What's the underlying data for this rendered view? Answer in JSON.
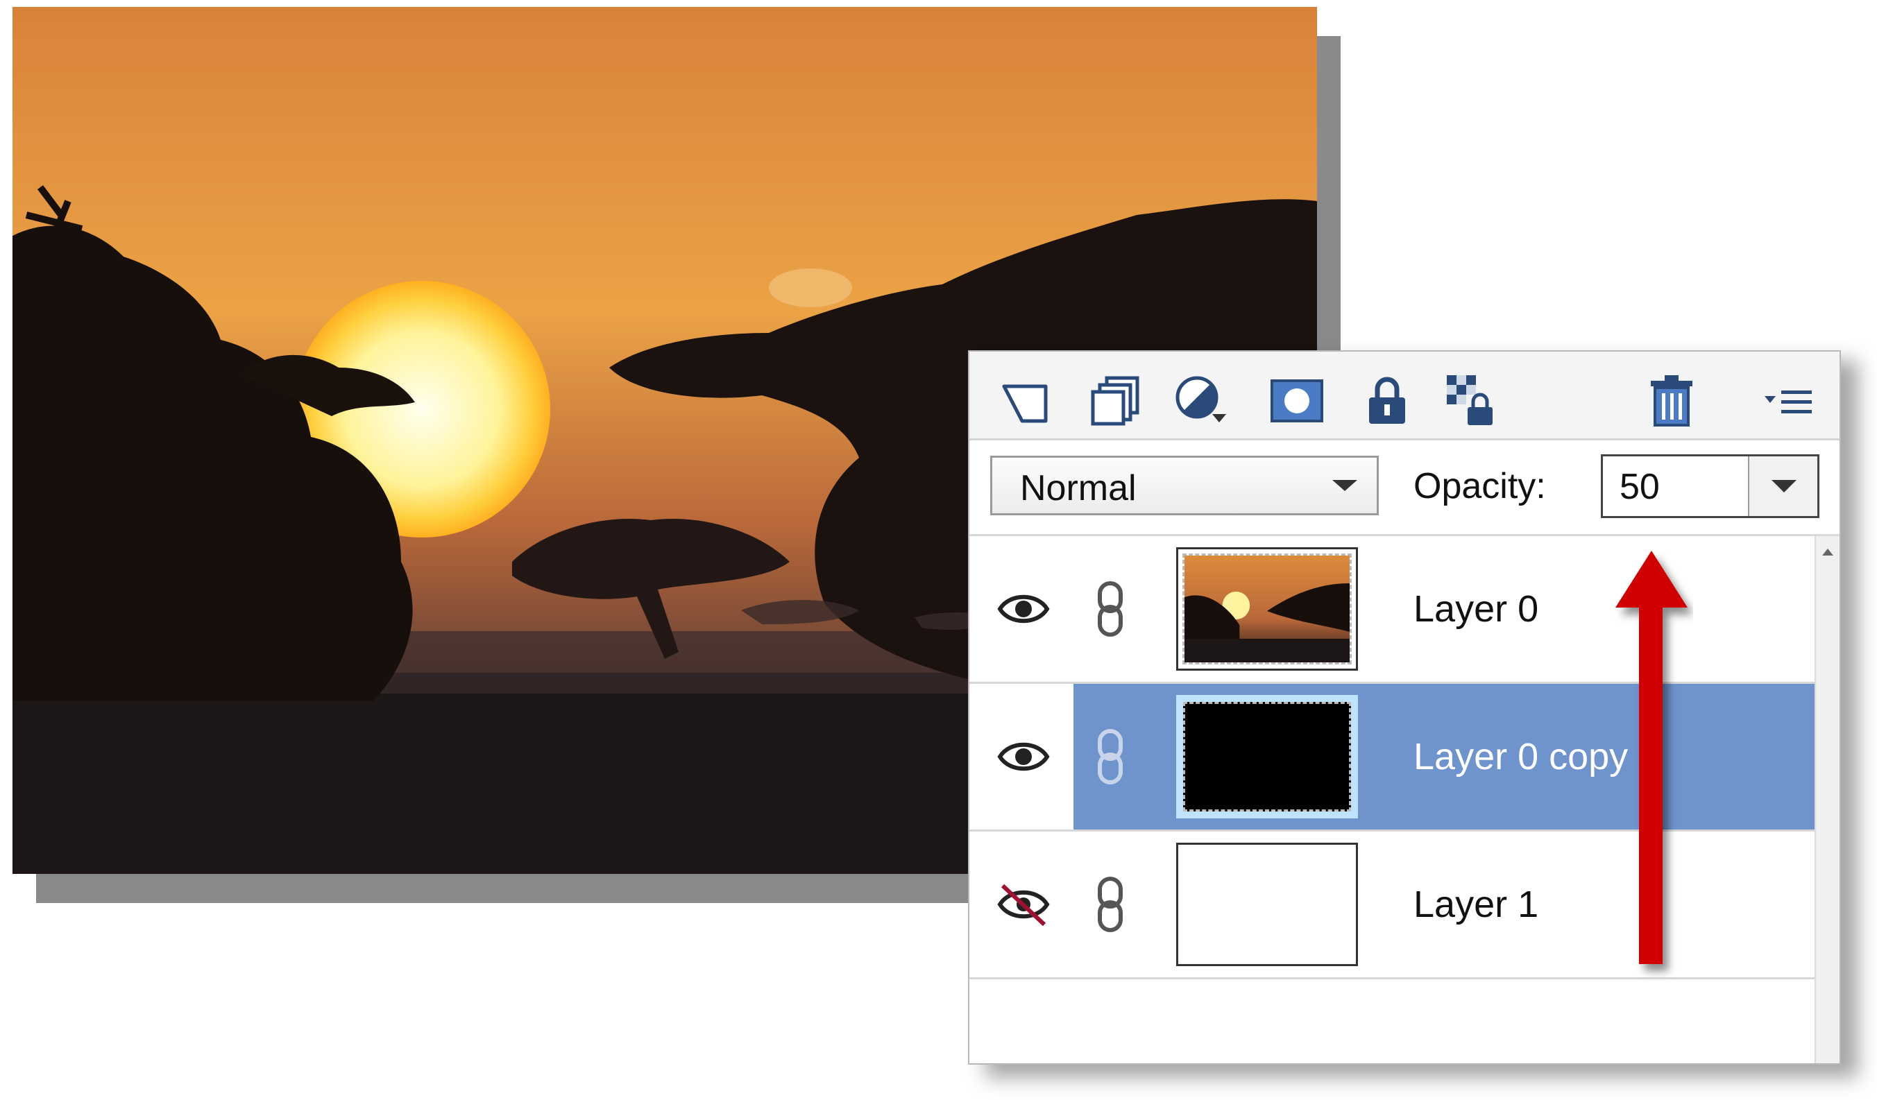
{
  "toolbar": {
    "icons": [
      "new-layer-icon",
      "duplicate-layer-icon",
      "adjustment-layer-icon",
      "mask-icon",
      "lock-icon",
      "lock-transparency-icon",
      "delete-icon",
      "panel-menu-icon"
    ]
  },
  "blend": {
    "mode": "Normal",
    "opacity_label": "Opacity:",
    "opacity_value": "50"
  },
  "layers": [
    {
      "name": "Layer 0",
      "visible": true,
      "selected": false
    },
    {
      "name": "Layer 0 copy",
      "visible": true,
      "selected": true
    },
    {
      "name": "Layer 1",
      "visible": false,
      "selected": false
    }
  ],
  "colors": {
    "selection": "#6e93cd",
    "annotation_arrow": "#d10000"
  }
}
